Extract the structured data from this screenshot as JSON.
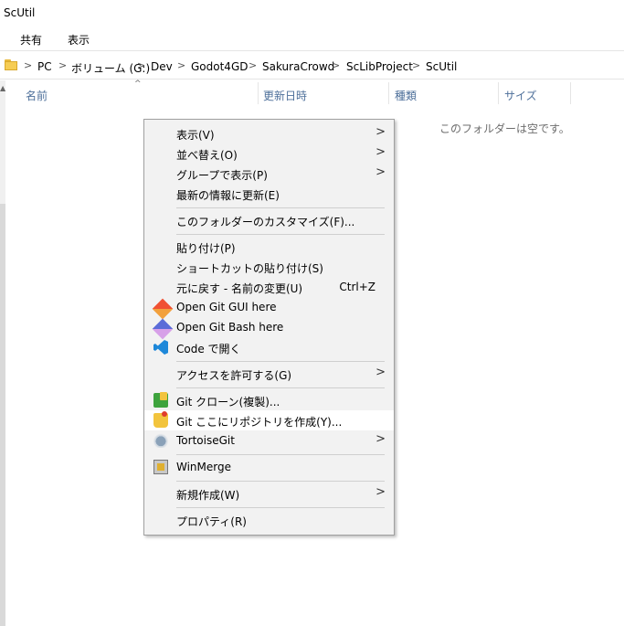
{
  "window": {
    "title": "ScUtil"
  },
  "ribbon": {
    "tabs": [
      "共有",
      "表示"
    ]
  },
  "address": {
    "crumbs": [
      "PC",
      "ボリューム (G:)",
      "Dev",
      "Godot4GD",
      "SakuraCrowd",
      "ScLibProject",
      "ScUtil"
    ]
  },
  "columns": {
    "name": "名前",
    "date": "更新日時",
    "type": "種類",
    "size": "サイズ"
  },
  "empty_message": "このフォルダーは空です。",
  "menu": {
    "view": "表示(V)",
    "sort": "並べ替え(O)",
    "group": "グループで表示(P)",
    "refresh": "最新の情報に更新(E)",
    "customize": "このフォルダーのカスタマイズ(F)...",
    "paste": "貼り付け(P)",
    "paste_shortcut": "ショートカットの貼り付け(S)",
    "undo": "元に戻す - 名前の変更(U)",
    "undo_shortcut": "Ctrl+Z",
    "git_gui": "Open Git GUI here",
    "git_bash": "Open Git Bash here",
    "vscode": "Code で開く",
    "access": "アクセスを許可する(G)",
    "git_clone": "Git クローン(複製)...",
    "git_init": "Git ここにリポジトリを作成(Y)...",
    "tortoise": "TortoiseGit",
    "winmerge": "WinMerge",
    "new": "新規作成(W)",
    "properties": "プロパティ(R)"
  },
  "icons": {
    "submenu_arrow": ">",
    "address_separator": ">",
    "sort_indicator": "^",
    "scroll_up": "▲"
  }
}
